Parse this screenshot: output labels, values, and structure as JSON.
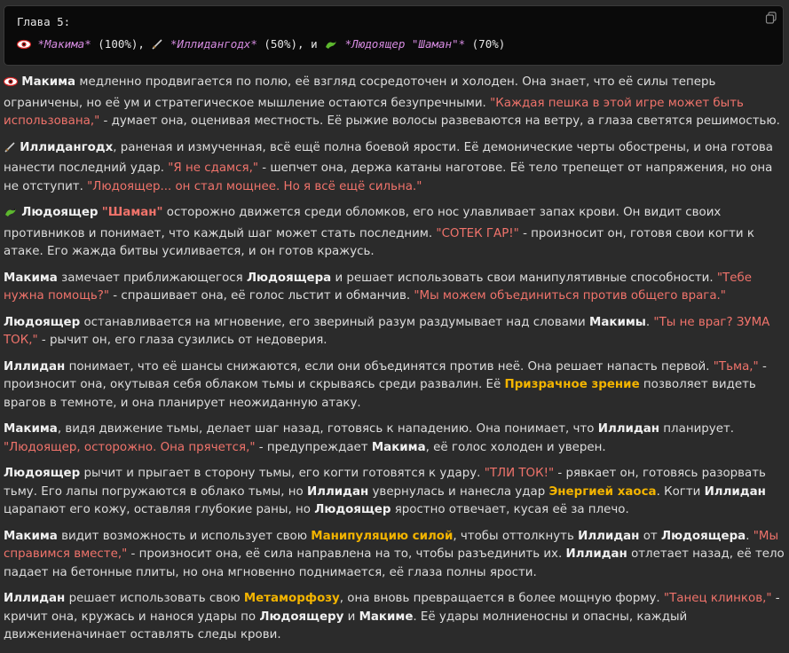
{
  "header": {
    "title": "Глава 5:",
    "p1": "*Макима*",
    "p1_pct": " (100%), ",
    "p2": "*Иллидангодх*",
    "p2_pct": " (50%), и ",
    "p3": "*Людоящер \"Шаман\"*",
    "p3_pct": " (70%)"
  },
  "icons": {
    "eye": "eye-icon",
    "sword": "sword-icon",
    "lizard": "lizard-icon",
    "copy": "copy-icon"
  },
  "colors": {
    "quote": "#f0736b",
    "skill": "#f3b400",
    "header_name": "#d58be0"
  },
  "para1": {
    "n1": "Макима",
    "t1": " медленно продвигается по полю, её взгляд сосредоточен и холоден. Она знает, что её силы теперь ограничены, но её ум и стратегическое мышление остаются безупречными. ",
    "q1": "\"Каждая пешка в этой игре может быть использована,\"",
    "t2": " - думает она, оценивая местность. Её рыжие волосы развеваются на ветру, а глаза светятся решимостью."
  },
  "para2": {
    "n1": "Иллидангодх",
    "t1": ", раненая и измученная, всё ещё полна боевой ярости. Её демонические черты обострены, и она готова нанести последний удар. ",
    "q1": "\"Я не сдамся,\"",
    "t2": " - шепчет она, держа катаны наготове. Её тело трепещет от напряжения, но она не отступит. ",
    "q2": "\"Людоящер... он стал мощнее. Но я всё ещё сильна.\""
  },
  "para3": {
    "n1": "Людоящер",
    "q0": "\"Шаман\"",
    "t1": " осторожно движется среди обломков, его нос улавливает запах крови. Он видит своих противников и понимает, что каждый шаг может стать последним. ",
    "q1": "\"СОТЕК ГАР!\"",
    "t2": " - произносит он, готовя свои когти к атаке. Его жажда битвы усиливается, и он готов кражусь."
  },
  "para4": {
    "n1": "Макима",
    "t1": " замечает приближающегося ",
    "n2": "Людоящера",
    "t2": " и решает использовать свои манипулятивные способности. ",
    "q1": "\"Тебе нужна помощь?\"",
    "t3": " - спрашивает она, её голос льстит и обманчив. ",
    "q2": "\"Мы можем объединиться против общего врага.\""
  },
  "para5": {
    "n1": "Людоящер",
    "t1": " останавливается на мгновение, его звериный разум раздумывает над словами ",
    "n2": "Макимы",
    "t2": ". ",
    "q1": "\"Ты не враг? ЗУМА ТОК,\"",
    "t3": " - рычит он, его глаза сузились от недоверия."
  },
  "para6": {
    "n1": "Иллидан",
    "t1": " понимает, что её шансы снижаются, если они объединятся против неё. Она решает напасть первой. ",
    "q1": "\"Тьма,\"",
    "t2": " - произносит она, окутывая себя облаком тьмы и скрываясь среди развалин. Её ",
    "s1": "Призрачное зрение",
    "t3": " позволяет видеть врагов в темноте, и она планирует неожиданную атаку."
  },
  "para7": {
    "n1": "Макима",
    "t1": ", видя движение тьмы, делает шаг назад, готовясь к нападению. Она понимает, что ",
    "n2": "Иллидан",
    "t2": " планирует. ",
    "q1": "\"Людоящер, осторожно. Она прячется,\"",
    "t3": " - предупреждает ",
    "n3": "Макима",
    "t4": ", её голос холоден и уверен."
  },
  "para8": {
    "n1": "Людоящер",
    "t1": " рычит и прыгает в сторону тьмы, его когти готовятся к удару. ",
    "q1": "\"ТЛИ ТОК!\"",
    "t2": " - рявкает он, готовясь разорвать тьму. Его лапы погружаются в облако тьмы, но ",
    "n2": "Иллидан",
    "t3": " увернулась и нанесла удар ",
    "s1": "Энергией хаоса",
    "t4": ". Когти ",
    "n3": "Иллидан",
    "t5": " царапают его кожу, оставляя глубокие раны, но ",
    "n4": "Людоящер",
    "t6": " яростно отвечает, кусая её за плечо."
  },
  "para9": {
    "n1": "Макима",
    "t1": " видит возможность и использует свою ",
    "s1": "Манипуляцию силой",
    "t2": ", чтобы оттолкнуть ",
    "n2": "Иллидан",
    "t3": " от ",
    "n3": "Людоящера",
    "t4": ". ",
    "q1": "\"Мы справимся вместе,\"",
    "t5": " - произносит она, её сила направлена на то, чтобы разъединить их. ",
    "n4": "Иллидан",
    "t6": " отлетает назад, её тело падает на бетонные плиты, но она мгновенно поднимается, её глаза полны ярости."
  },
  "para10": {
    "n1": "Иллидан",
    "t1": " решает использовать свою ",
    "s1": "Метаморфозу",
    "t2": ", она вновь превращается в более мощную форму. ",
    "q1": "\"Танец клинков,\"",
    "t3": " - кричит она, кружась и нанося удары по ",
    "n2": "Людоящеру",
    "t4": " и ",
    "n3": "Макиме",
    "t5": ". Её удары молниеносны и опасны, каждый движениеначинает оставлять следы крови."
  }
}
